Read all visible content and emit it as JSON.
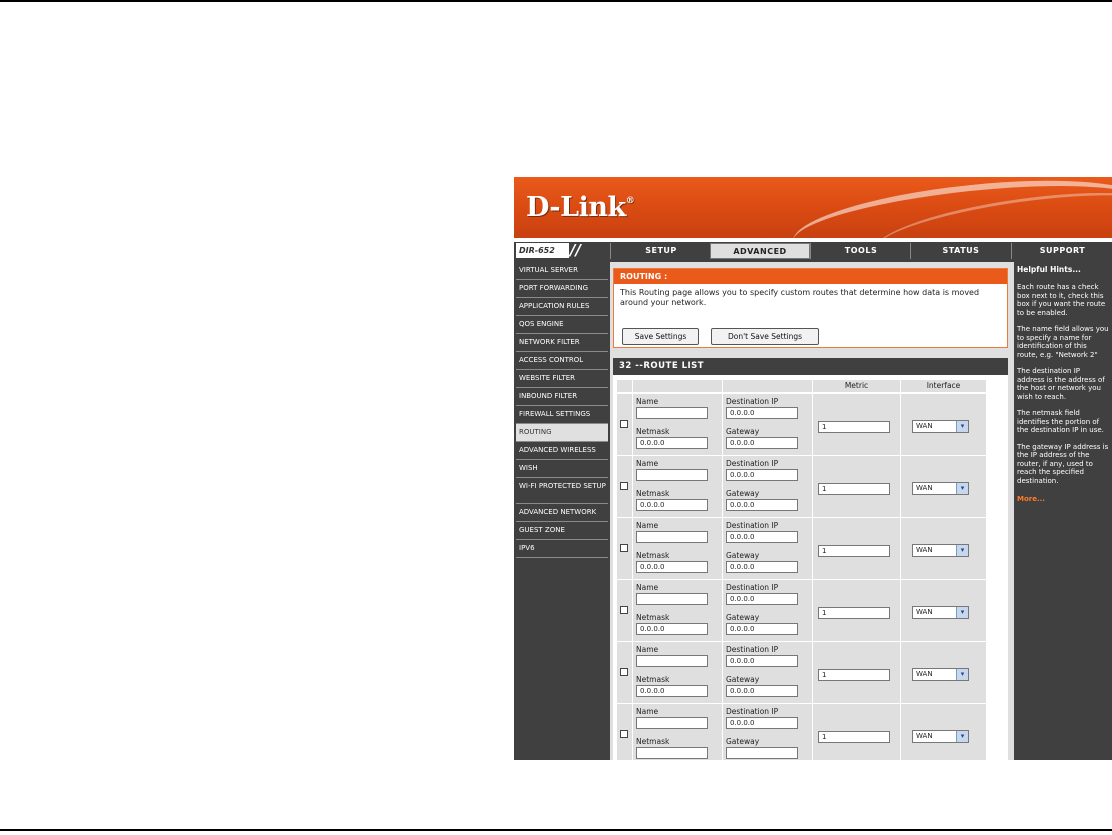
{
  "brand": {
    "logo": "D-Link",
    "reg_mark": "®"
  },
  "model": "DIR-652",
  "model_slashes": "//",
  "tabs": [
    {
      "label": "SETUP",
      "active": false
    },
    {
      "label": "ADVANCED",
      "active": true
    },
    {
      "label": "TOOLS",
      "active": false
    },
    {
      "label": "STATUS",
      "active": false
    },
    {
      "label": "SUPPORT",
      "active": false
    }
  ],
  "sidebar": {
    "items": [
      "VIRTUAL SERVER",
      "PORT FORWARDING",
      "APPLICATION RULES",
      "QOS ENGINE",
      "NETWORK FILTER",
      "ACCESS CONTROL",
      "WEBSITE FILTER",
      "INBOUND FILTER",
      "FIREWALL SETTINGS",
      "ROUTING",
      "ADVANCED WIRELESS",
      "WISH",
      "WI-FI PROTECTED SETUP",
      "ADVANCED NETWORK",
      "GUEST ZONE",
      "IPV6"
    ],
    "active_index": 9
  },
  "routing": {
    "title": "ROUTING :",
    "description": "This Routing page allows you to specify custom routes that determine how data is moved around your network.",
    "save_label": "Save Settings",
    "dont_save_label": "Don't Save Settings"
  },
  "route_list": {
    "title": "32 --ROUTE LIST",
    "headers": {
      "metric": "Metric",
      "interface": "Interface"
    },
    "labels": {
      "name": "Name",
      "destination_ip": "Destination IP",
      "netmask": "Netmask",
      "gateway": "Gateway"
    },
    "rows": [
      {
        "name": "",
        "destination_ip": "0.0.0.0",
        "netmask": "0.0.0.0",
        "gateway": "0.0.0.0",
        "metric": "1",
        "interface": "WAN",
        "checked": false
      },
      {
        "name": "",
        "destination_ip": "0.0.0.0",
        "netmask": "0.0.0.0",
        "gateway": "0.0.0.0",
        "metric": "1",
        "interface": "WAN",
        "checked": false
      },
      {
        "name": "",
        "destination_ip": "0.0.0.0",
        "netmask": "0.0.0.0",
        "gateway": "0.0.0.0",
        "metric": "1",
        "interface": "WAN",
        "checked": false
      },
      {
        "name": "",
        "destination_ip": "0.0.0.0",
        "netmask": "0.0.0.0",
        "gateway": "0.0.0.0",
        "metric": "1",
        "interface": "WAN",
        "checked": false
      },
      {
        "name": "",
        "destination_ip": "0.0.0.0",
        "netmask": "0.0.0.0",
        "gateway": "0.0.0.0",
        "metric": "1",
        "interface": "WAN",
        "checked": false
      },
      {
        "name": "",
        "destination_ip": "0.0.0.0",
        "netmask": "",
        "gateway": "",
        "metric": "1",
        "interface": "WAN",
        "checked": false
      }
    ]
  },
  "hints": {
    "title": "Helpful Hints...",
    "items": [
      "Each route has a check box next to it, check this box if you want the route to be enabled.",
      "The name field allows you to specify a name for identification of this route, e.g. \"Network 2\"",
      "The destination IP address is the address of the host or network you wish to reach.",
      "The netmask field identifies the portion of the destination IP in use.",
      "The gateway IP address is the IP address of the router, if any, used to reach the specified destination."
    ],
    "more": "More..."
  },
  "colors": {
    "brand_orange": "#ea5a1b",
    "nav_dark": "#404040",
    "panel_gray": "#dfdfdf",
    "hint_link": "#ff7a2a"
  }
}
